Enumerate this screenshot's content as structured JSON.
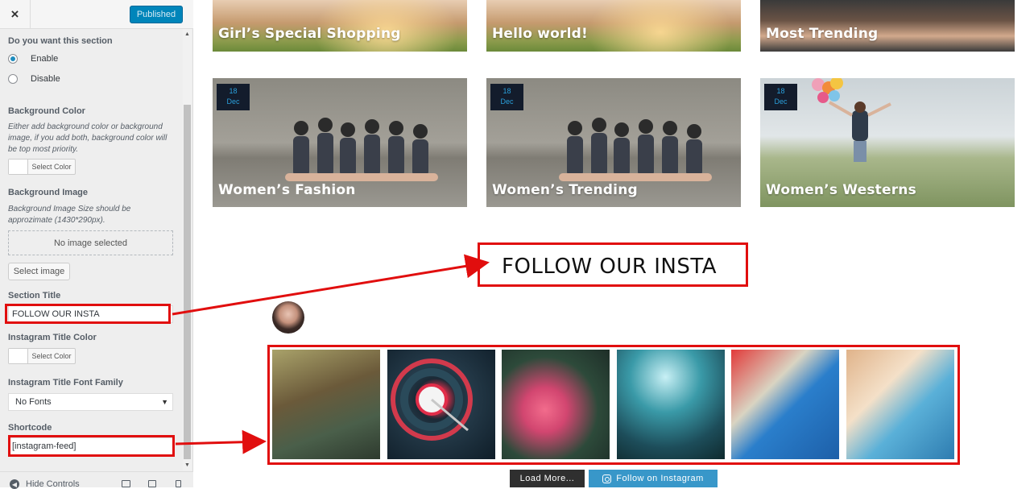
{
  "header": {
    "close_icon": "×",
    "publish_label": "Published"
  },
  "section_toggle": {
    "label": "Do you want this section",
    "options": [
      {
        "label": "Enable",
        "checked": true
      },
      {
        "label": "Disable",
        "checked": false
      }
    ]
  },
  "background_color": {
    "label": "Background Color",
    "description": "Either add background color or background image, if you add both, background color will be top most priority.",
    "button_label": "Select Color"
  },
  "background_image": {
    "label": "Background Image",
    "description": "Background Image Size should be approzimate (1430*290px).",
    "placeholder": "No image selected",
    "button_label": "Select image"
  },
  "section_title": {
    "label": "Section Title",
    "value": "FOLLOW OUR INSTA"
  },
  "instagram_title_color": {
    "label": "Instagram Title Color",
    "button_label": "Select Color"
  },
  "instagram_font": {
    "label": "Instagram Title Font Family",
    "value": "No Fonts"
  },
  "shortcode": {
    "label": "Shortcode",
    "value": "[instagram-feed]"
  },
  "footer": {
    "hide_controls_label": "Hide Controls"
  },
  "preview": {
    "top_cards": [
      {
        "title": "Girl’s Special Shopping"
      },
      {
        "title": "Hello world!"
      },
      {
        "title": "Most Trending"
      }
    ],
    "cards": [
      {
        "title": "Women’s Fashion",
        "day": "18",
        "month": "Dec"
      },
      {
        "title": "Women’s Trending",
        "day": "18",
        "month": "Dec"
      },
      {
        "title": "Women’s Westerns",
        "day": "18",
        "month": "Dec"
      }
    ],
    "insta_title": "FOLLOW OUR INSTA",
    "load_more_label": "Load More...",
    "follow_label": "Follow on Instagram"
  },
  "colors": {
    "accent": "#0085ba",
    "highlight": "#e10e0e",
    "badge_bg": "#131c2c",
    "badge_text": "#2aa0dc",
    "follow_btn": "#3897c9"
  }
}
